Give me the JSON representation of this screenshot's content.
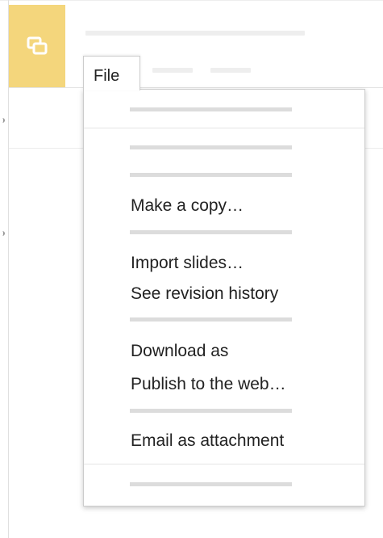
{
  "menubar": {
    "file_label": "File"
  },
  "icons": {
    "app_logo": "slides-icon"
  },
  "colors": {
    "logo_background": "#f4d67c",
    "placeholder": "#eeeeee",
    "menu_placeholder": "#dcdcdc",
    "text": "#222222"
  },
  "file_menu": {
    "items": [
      {
        "label": "Make a copy…"
      },
      {
        "label": "Import slides…"
      },
      {
        "label": "See revision history"
      },
      {
        "label": "Download as"
      },
      {
        "label": "Publish to the web…"
      },
      {
        "label": "Email as attachment"
      }
    ]
  }
}
